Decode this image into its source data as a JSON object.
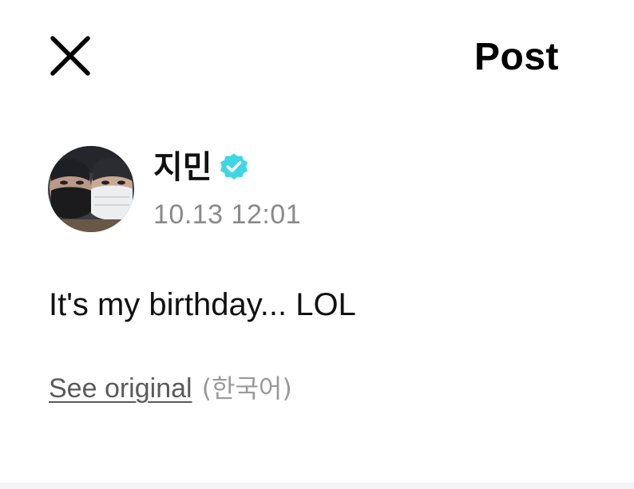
{
  "header": {
    "title": "Post",
    "close_icon": "close-icon"
  },
  "post": {
    "author_name": "지민",
    "verified_icon": "verified-badge-icon",
    "verified_color": "#3fd6e4",
    "timestamp": "10.13 12:01",
    "text": "It's my birthday... LOL",
    "see_original_label": "See original",
    "original_language": "(한국어)"
  }
}
